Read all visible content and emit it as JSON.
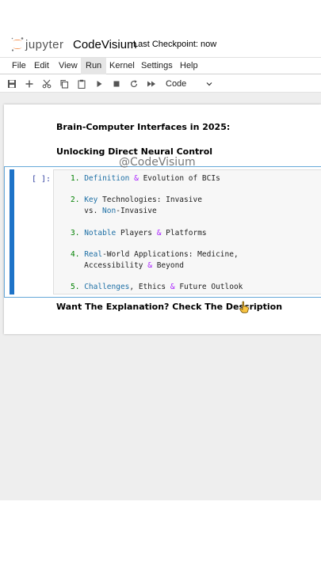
{
  "header": {
    "logo_text": "jupyter",
    "notebook_title": "CodeVisium",
    "checkpoint": "Last Checkpoint: now"
  },
  "menu": {
    "items": [
      "File",
      "Edit",
      "View",
      "Run",
      "Kernel",
      "Settings",
      "Help"
    ],
    "active": "Run"
  },
  "toolbar": {
    "icons": [
      "save-icon",
      "add-icon",
      "cut-icon",
      "copy-icon",
      "paste-icon",
      "run-icon",
      "stop-icon",
      "restart-icon",
      "fast-forward-icon"
    ],
    "cell_type": "Code"
  },
  "notebook": {
    "heading_1": "Brain-Computer Interfaces in 2025:",
    "heading_2": "Unlocking Direct Neural Control",
    "watermark": "@CodeVisium",
    "cell_prompt": "[ ]:",
    "code_lines": [
      {
        "num": "1.",
        "kw": "Definition",
        "rest": " ",
        "amp": "&",
        "tail": " Evolution of BCIs"
      },
      {
        "num": "2.",
        "kw": "Key",
        "rest": " Technologies: Invasive"
      },
      {
        "rest": "   vs. ",
        "kw": "Non",
        "tail": "-Invasive"
      },
      {
        "num": "3.",
        "kw": "Notable",
        "rest": " Players ",
        "amp": "&",
        "tail": " Platforms"
      },
      {
        "num": "4.",
        "kw": "Real",
        "rest": "-World Applications: Medicine,"
      },
      {
        "rest": "   Accessibility ",
        "amp": "&",
        "tail": " Beyond"
      },
      {
        "num": "5.",
        "kw": "Challenges",
        "rest": ", Ethics ",
        "amp": "&",
        "tail": " Future Outlook"
      }
    ],
    "footer": "Want The Explanation? Check The Description"
  }
}
